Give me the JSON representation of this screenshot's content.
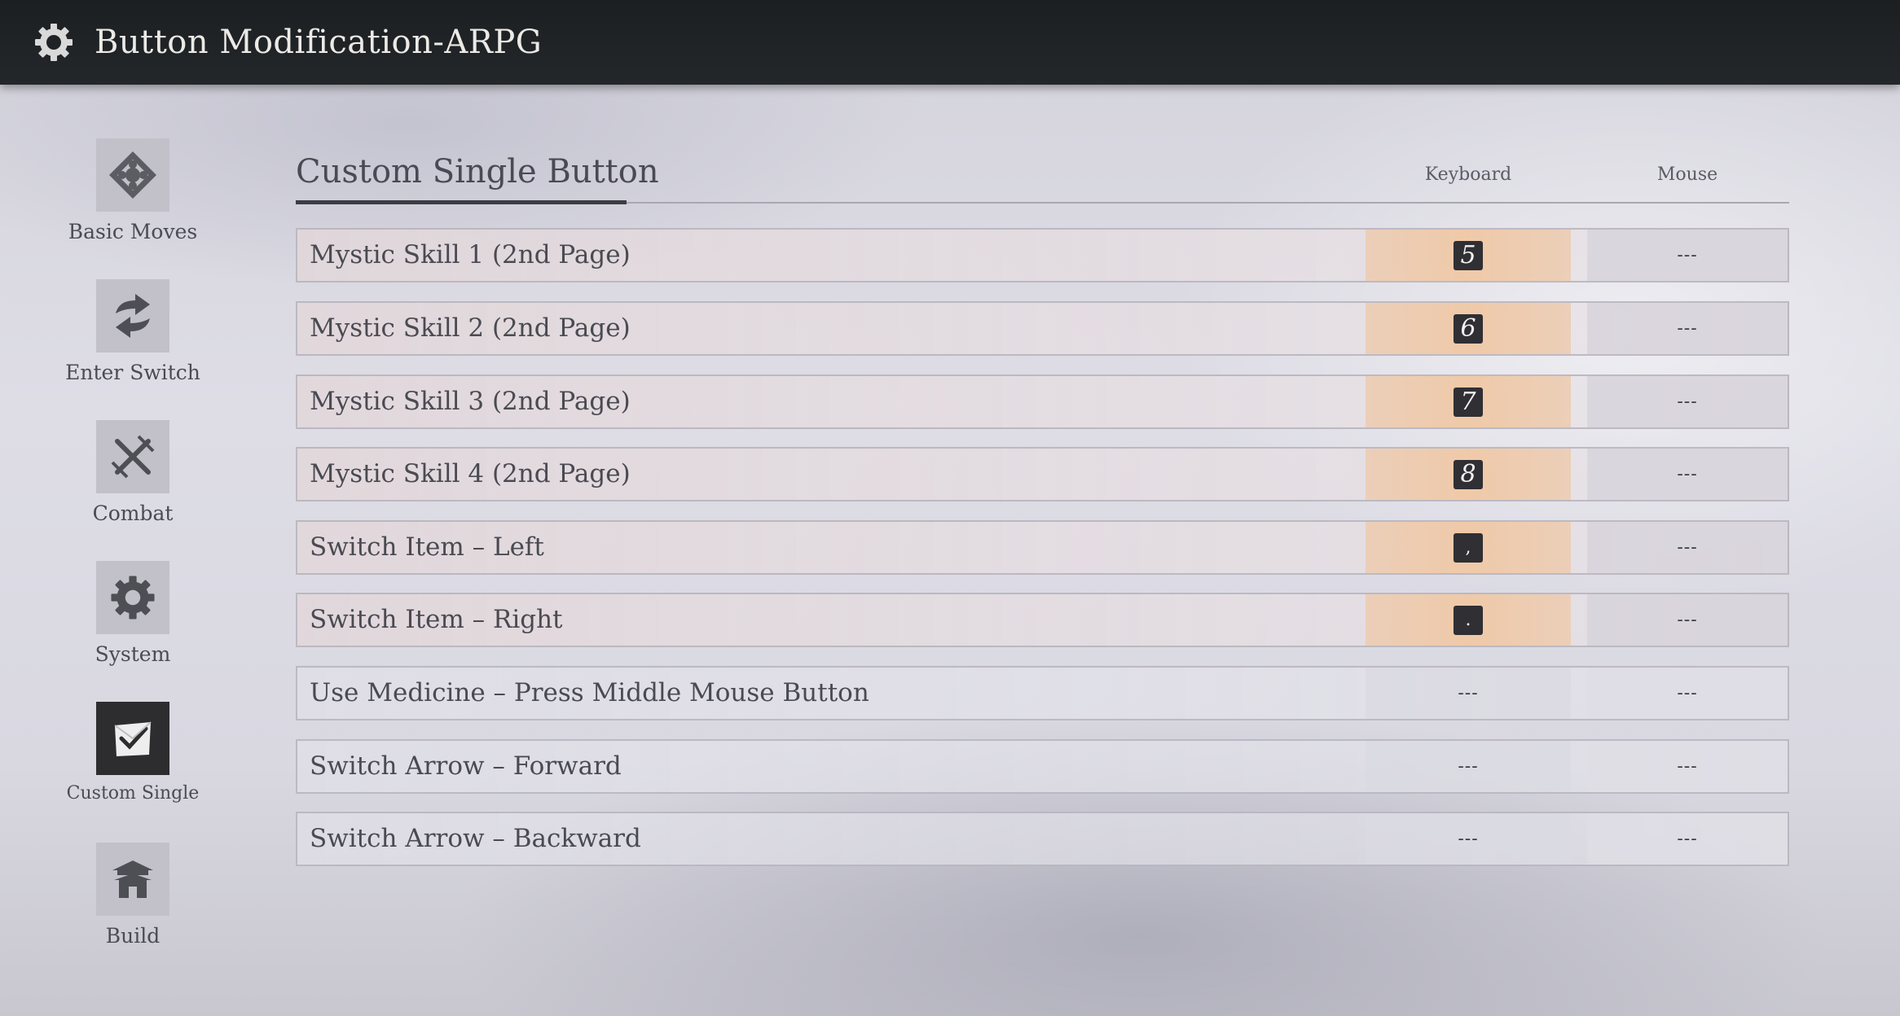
{
  "header": {
    "title": "Button Modification-ARPG",
    "icon": "gear-icon"
  },
  "sidebar": {
    "items": [
      {
        "label": "Basic Moves",
        "icon": "diamond-move-icon",
        "active": false
      },
      {
        "label": "Enter Switch",
        "icon": "switch-arrows-icon",
        "active": false
      },
      {
        "label": "Combat",
        "icon": "crossed-swords-icon",
        "active": false
      },
      {
        "label": "System",
        "icon": "gear-icon",
        "active": false
      },
      {
        "label": "Custom Single",
        "icon": "custom-check-icon",
        "active": true
      },
      {
        "label": "Build",
        "icon": "pavilion-icon",
        "active": false
      }
    ]
  },
  "main": {
    "section_title": "Custom Single Button",
    "columns": {
      "keyboard": "Keyboard",
      "mouse": "Mouse"
    },
    "rows": [
      {
        "name": "Mystic Skill 1 (2nd Page)",
        "keyboard": "5",
        "mouse": "---"
      },
      {
        "name": "Mystic Skill 2 (2nd Page)",
        "keyboard": "6",
        "mouse": "---"
      },
      {
        "name": "Mystic Skill 3 (2nd Page)",
        "keyboard": "7",
        "mouse": "---"
      },
      {
        "name": "Mystic Skill 4 (2nd Page)",
        "keyboard": "8",
        "mouse": "---"
      },
      {
        "name": "Switch Item – Left",
        "keyboard": ",",
        "mouse": "---"
      },
      {
        "name": "Switch Item – Right",
        "keyboard": ".",
        "mouse": "---"
      },
      {
        "name": "Use Medicine – Press Middle Mouse Button",
        "keyboard": "---",
        "mouse": "---"
      },
      {
        "name": "Switch Arrow – Forward",
        "keyboard": "---",
        "mouse": "---"
      },
      {
        "name": "Switch Arrow – Backward",
        "keyboard": "---",
        "mouse": "---"
      }
    ]
  },
  "colors": {
    "topbar": "#1f2326",
    "key_highlight": "#f0c8a5",
    "active_tab": "#2d2d30"
  }
}
